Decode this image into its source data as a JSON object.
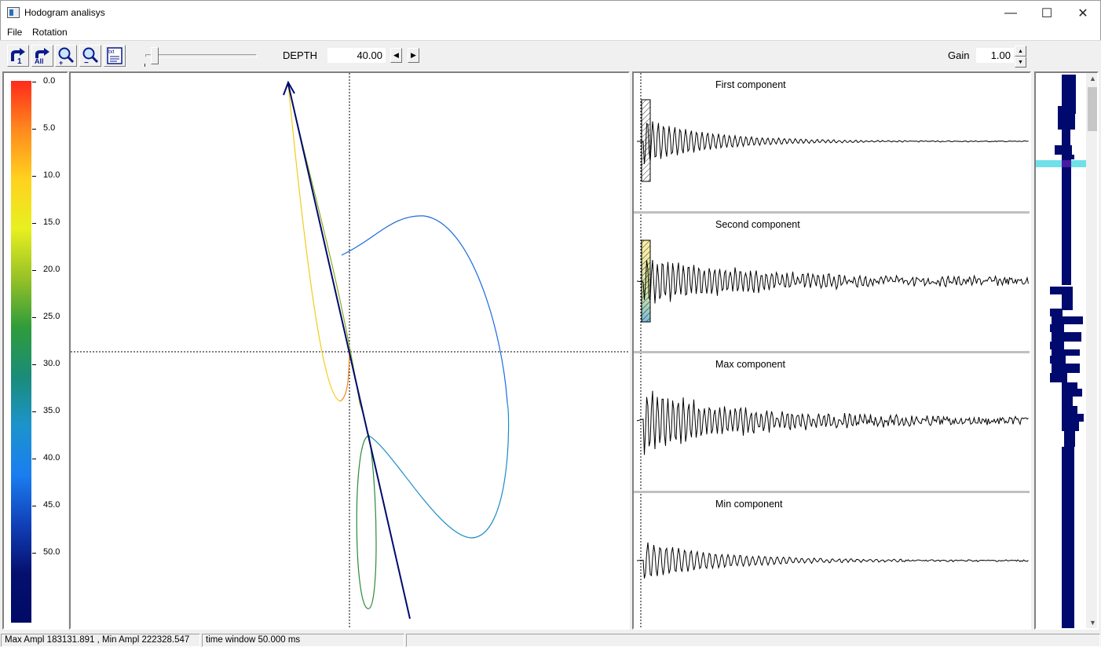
{
  "window": {
    "title": "Hodogram analisys",
    "minimize_glyph": "—",
    "maximize_glyph": "☐",
    "close_glyph": "✕"
  },
  "menu": {
    "items": [
      {
        "label": "File"
      },
      {
        "label": "Rotation"
      }
    ]
  },
  "toolbar": {
    "buttons": [
      {
        "icon": "rotate-1-icon",
        "caption": "1"
      },
      {
        "icon": "rotate-all-icon",
        "caption": "All"
      },
      {
        "icon": "zoom-in-icon"
      },
      {
        "icon": "zoom-out-icon"
      },
      {
        "icon": "text-report-icon",
        "caption": "txt"
      }
    ],
    "depth_label": "DEPTH",
    "depth_value": "40.00",
    "gain_label": "Gain",
    "gain_value": "1.00",
    "slider_position": 0.05
  },
  "color_scale": {
    "labels": [
      "0.0",
      "5.0",
      "10.0",
      "15.0",
      "20.0",
      "25.0",
      "30.0",
      "35.0",
      "40.0",
      "45.0",
      "50.0"
    ],
    "colors": [
      "#ff2a1a",
      "#ff8a1e",
      "#ffd21e",
      "#e8f020",
      "#98c226",
      "#2f9c3a",
      "#1a8c78",
      "#1c93cc",
      "#1a7ef0",
      "#1140b8",
      "#05106e",
      "#000a66"
    ]
  },
  "components": [
    {
      "title": "First component"
    },
    {
      "title": "Second component"
    },
    {
      "title": "Max component"
    },
    {
      "title": "Min component"
    }
  ],
  "status": {
    "amplitude": "Max Ampl  183131.891 , Min Ampl 222328.547",
    "time_window": "time window  50.000 ms"
  }
}
